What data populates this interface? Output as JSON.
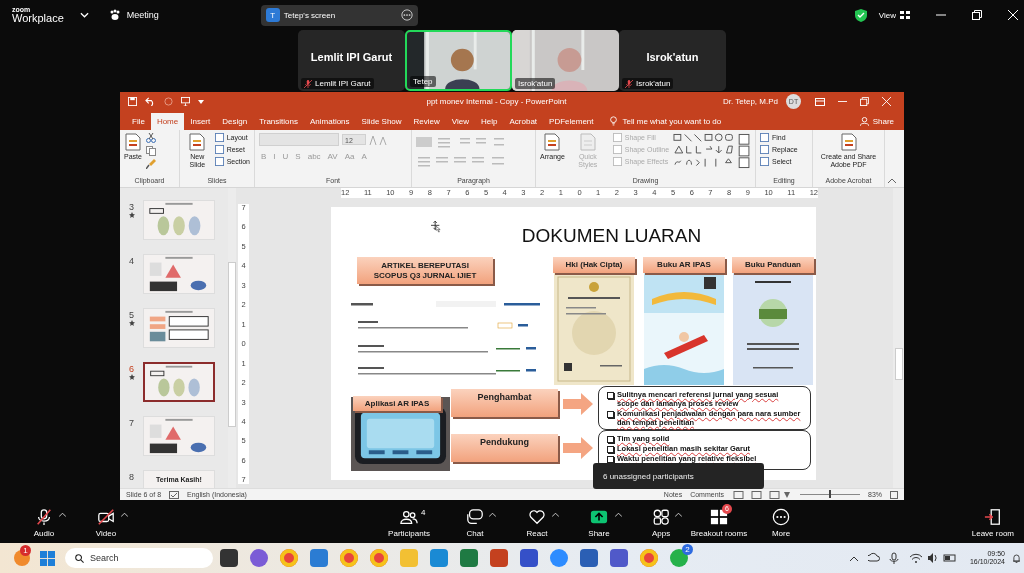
{
  "top_bar": {
    "logo_small": "zoom",
    "logo_large": "Workplace",
    "meeting": "Meeting",
    "screen_share": {
      "initial": "T",
      "label": "Tetep's screen"
    },
    "view": "View"
  },
  "video_tiles": [
    {
      "kind": "name",
      "title": "Lemlit IPI Garut",
      "label": "Lemlit IPI Garut",
      "muted": true,
      "speaking": false
    },
    {
      "kind": "camera",
      "label": "Tetep",
      "muted": false,
      "speaking": true
    },
    {
      "kind": "camera",
      "label": "Isrok'atun",
      "muted": false,
      "speaking": false
    },
    {
      "kind": "name",
      "title": "Isrok'atun",
      "label": "Isrok'atun",
      "muted": true,
      "speaking": false
    }
  ],
  "powerpoint": {
    "title": "ppt monev Internal - Copy  -  PowerPoint",
    "user": "Dr. Tetep, M.Pd",
    "avatar": "DT",
    "tabs": [
      {
        "label": "File",
        "selected": false
      },
      {
        "label": "Home",
        "selected": true
      },
      {
        "label": "Insert",
        "selected": false
      },
      {
        "label": "Design",
        "selected": false
      },
      {
        "label": "Transitions",
        "selected": false
      },
      {
        "label": "Animations",
        "selected": false
      },
      {
        "label": "Slide Show",
        "selected": false
      },
      {
        "label": "Review",
        "selected": false
      },
      {
        "label": "View",
        "selected": false
      },
      {
        "label": "Help",
        "selected": false
      },
      {
        "label": "Acrobat",
        "selected": false
      },
      {
        "label": "PDFelement",
        "selected": false
      }
    ],
    "tell_me": "Tell me what you want to do",
    "share": "Share",
    "ribbon": [
      {
        "name": "Clipboard",
        "kind": "clipboard",
        "disabled": false,
        "items": [
          {
            "label": "Paste",
            "kind": "big",
            "disabled": false
          }
        ]
      },
      {
        "name": "Slides",
        "kind": "slides",
        "disabled": false,
        "items": [
          {
            "label": "New Slide",
            "kind": "big",
            "disabled": false
          },
          {
            "label": "Layout",
            "kind": "small",
            "disabled": false
          },
          {
            "label": "Reset",
            "kind": "small",
            "disabled": false
          },
          {
            "label": "Section",
            "kind": "small",
            "disabled": false
          }
        ]
      },
      {
        "name": "Font",
        "kind": "font",
        "disabled": true,
        "size": "12",
        "glyphs": [
          "B",
          "I",
          "U",
          "S",
          "abc",
          "AV",
          "Aa",
          "A"
        ]
      },
      {
        "name": "Paragraph",
        "kind": "paragraph",
        "disabled": true
      },
      {
        "name": "Drawing",
        "kind": "drawing",
        "disabled": false,
        "items": [
          {
            "label": "Arrange",
            "kind": "big",
            "disabled": false
          },
          {
            "label": "Quick Styles",
            "kind": "big",
            "disabled": true
          },
          {
            "label": "Shape Fill",
            "kind": "small",
            "disabled": true
          },
          {
            "label": "Shape Outline",
            "kind": "small",
            "disabled": true
          },
          {
            "label": "Shape Effects",
            "kind": "small",
            "disabled": true
          }
        ]
      },
      {
        "name": "Editing",
        "kind": "editing",
        "disabled": false,
        "items": [
          {
            "label": "Find",
            "kind": "small",
            "disabled": false
          },
          {
            "label": "Replace",
            "kind": "small",
            "disabled": false
          },
          {
            "label": "Select",
            "kind": "small",
            "disabled": false
          }
        ]
      },
      {
        "name": "Adobe Acrobat",
        "kind": "acrobat",
        "disabled": false,
        "items": [
          {
            "label": "Create and Share Adobe PDF",
            "kind": "big",
            "disabled": false
          }
        ]
      }
    ],
    "ruler": {
      "horizontal": [
        "12",
        "11",
        "10",
        "9",
        "8",
        "7",
        "6",
        "5",
        "4",
        "3",
        "2",
        "1",
        "0",
        "1",
        "2",
        "3",
        "4",
        "5",
        "6",
        "7",
        "8",
        "9",
        "10",
        "11",
        "12"
      ],
      "vertical": [
        "7",
        "6",
        "5",
        "4",
        "3",
        "2",
        "1",
        "0",
        "1",
        "2",
        "3",
        "4",
        "5",
        "6",
        "7"
      ]
    },
    "thumbnails": [
      {
        "number": "3",
        "star": true,
        "selected": false
      },
      {
        "number": "4",
        "star": false,
        "selected": false
      },
      {
        "number": "5",
        "star": true,
        "selected": false
      },
      {
        "number": "6",
        "star": true,
        "selected": true
      },
      {
        "number": "7",
        "star": false,
        "selected": false
      },
      {
        "number": "8",
        "star": false,
        "selected": false,
        "text": "Terima Kasih!"
      }
    ],
    "slide": {
      "title": "DOKUMEN LUARAN",
      "article_label": "ARTIKEL BEREPUTASI SCOPUS Q3 JURNAL IJIET",
      "documents": [
        {
          "label": "Hki (Hak Cipta)"
        },
        {
          "label": "Buku AR IPAS"
        },
        {
          "label": "Buku Panduan"
        }
      ],
      "app_label": "Aplikasi AR IPAS",
      "factors": [
        {
          "label": "Penghambat",
          "points": [
            "Sulitnya mencari referensi jurnal yang sesuai scope dan lamanya proses review",
            "Komunikasi penjadwalan dengan para nara sumber dan tempat penelitian"
          ]
        },
        {
          "label": "Pendukung",
          "points": [
            "Tim yang solid",
            "Lokasi penelitian masih sekitar Garut",
            "Waktu penelitian yang relative fleksibel"
          ]
        }
      ]
    },
    "status_bar": {
      "slide": "Slide 6 of 8",
      "language": "English (Indonesia)",
      "notes": "Notes",
      "comments": "Comments",
      "zoom_slider": {
        "level": 0.5
      },
      "zoom": "83%"
    }
  },
  "toolbar": {
    "left_items": [
      {
        "label": "Audio",
        "kind": "mic",
        "off": true,
        "caret": true
      },
      {
        "label": "Video",
        "kind": "camera",
        "off": true,
        "caret": true
      }
    ],
    "center_items": [
      {
        "label": "Participants",
        "kind": "people",
        "count": "4",
        "caret": false
      },
      {
        "label": "Chat",
        "kind": "chat",
        "caret": true
      },
      {
        "label": "React",
        "kind": "heart",
        "caret": true
      },
      {
        "label": "Share",
        "kind": "share",
        "caret": true
      },
      {
        "label": "Apps",
        "kind": "apps",
        "caret": true
      },
      {
        "label": "Breakout rooms",
        "kind": "grid",
        "badge": "6",
        "caret": false
      },
      {
        "label": "More",
        "kind": "more",
        "caret": false
      }
    ],
    "leave": "Leave room"
  },
  "tooltip": "6 unassigned participants",
  "taskbar": {
    "notification_badge": "1",
    "search": "Search",
    "apps": [
      {
        "kind": "doc"
      },
      {
        "kind": "swirl"
      },
      {
        "kind": "ring"
      },
      {
        "kind": "window"
      },
      {
        "kind": "ring"
      },
      {
        "kind": "ring"
      },
      {
        "kind": "folder"
      },
      {
        "kind": "wave"
      },
      {
        "kind": "sheet"
      },
      {
        "kind": "slides"
      },
      {
        "kind": "scanner"
      },
      {
        "kind": "camera"
      },
      {
        "kind": "docblue"
      },
      {
        "kind": "team"
      },
      {
        "kind": "ring"
      },
      {
        "kind": "phone",
        "badge": "2"
      }
    ],
    "time": "09:50",
    "date": "16/10/2024"
  }
}
